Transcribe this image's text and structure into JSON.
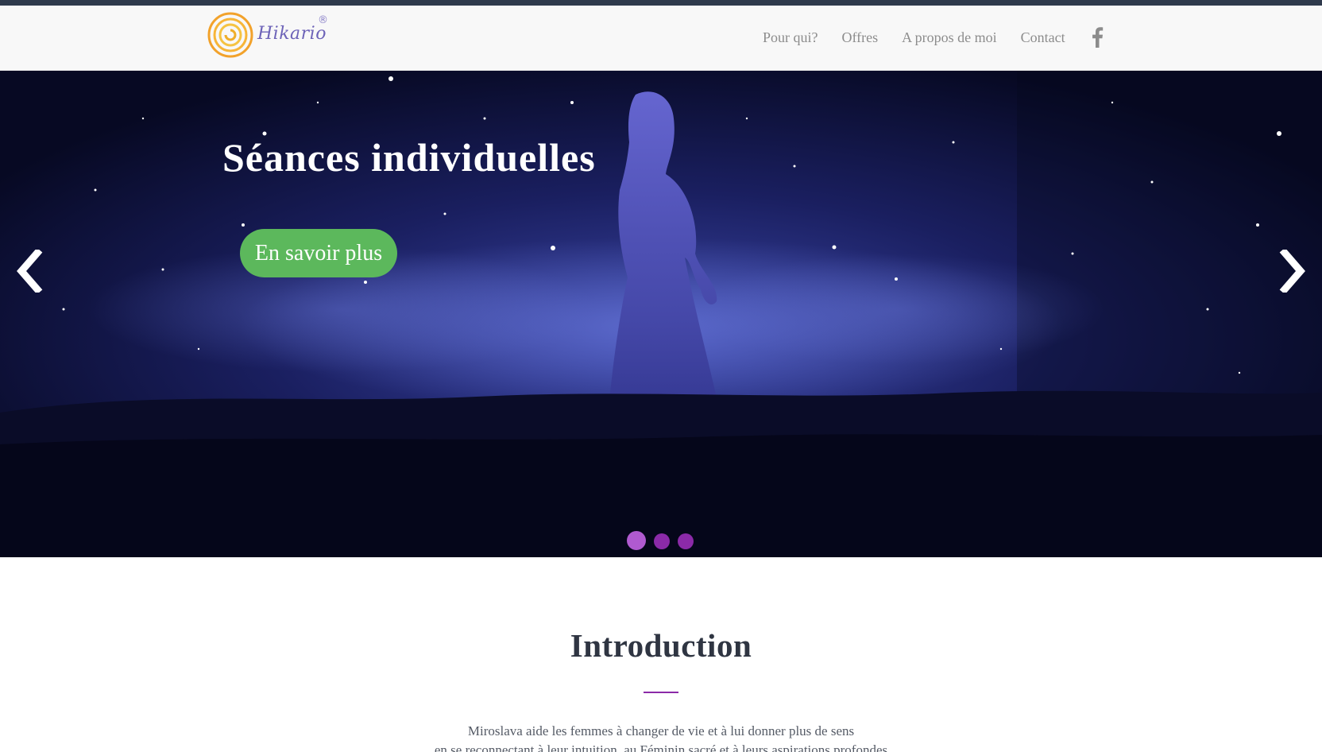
{
  "header": {
    "logo_text": "Hikario",
    "logo_mark": "®",
    "nav": [
      {
        "label": "Pour qui?"
      },
      {
        "label": "Offres"
      },
      {
        "label": "A propos de moi"
      },
      {
        "label": "Contact"
      }
    ],
    "social_icon": "facebook-icon"
  },
  "hero": {
    "title": "Séances individuelles",
    "button_label": "En savoir plus",
    "slides_count": 3,
    "active_slide": 1,
    "colors": {
      "button": "#5cb85c",
      "dot": "#8b2aa8",
      "dot_active": "#b05ad0"
    }
  },
  "intro": {
    "title": "Introduction",
    "lines": [
      "Miroslava aide les femmes à changer de vie et à lui donner plus de sens",
      "en se reconnectant à leur intuition, au Féminin sacré et à leurs aspirations profondes"
    ],
    "accent_color": "#8b2aa8"
  }
}
